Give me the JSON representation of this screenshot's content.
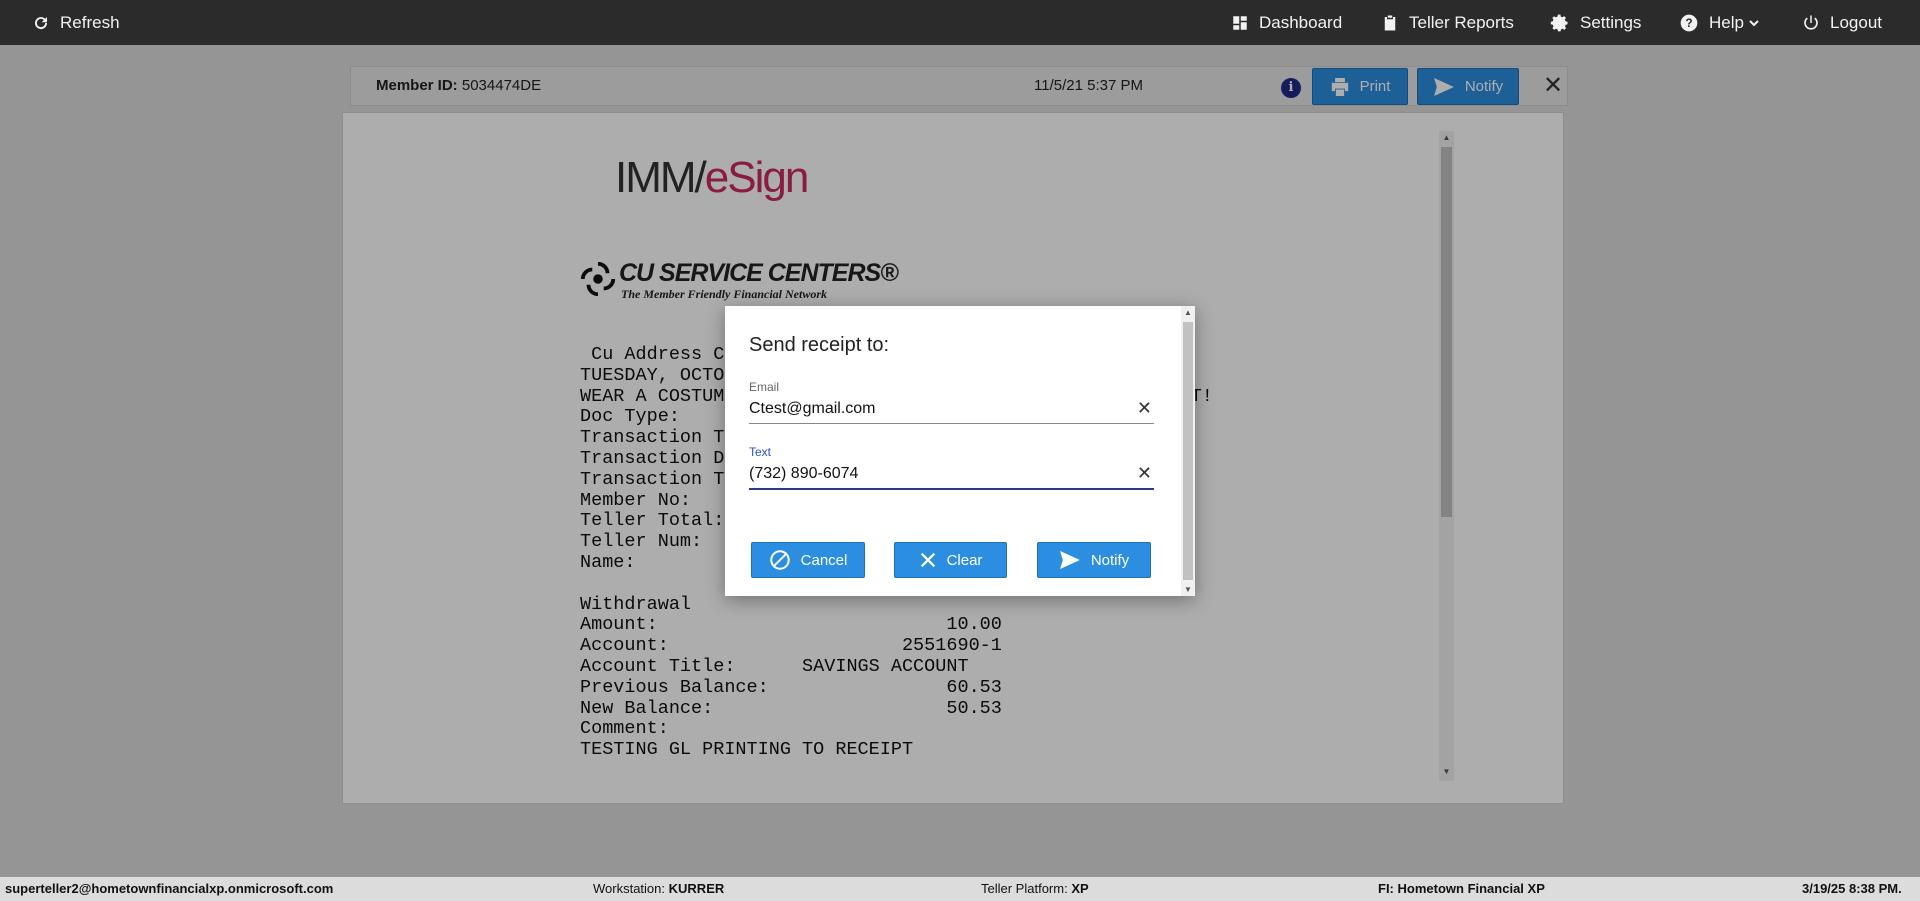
{
  "topbar": {
    "refresh": "Refresh",
    "dashboard": "Dashboard",
    "teller_reports": "Teller Reports",
    "settings": "Settings",
    "help": "Help",
    "logout": "Logout"
  },
  "receipt_header": {
    "member_label": "Member ID:",
    "member_id": "5034474DE",
    "datetime": "11/5/21 5:37 PM",
    "info": "i",
    "print_label": "Print",
    "notify_label": "Notify",
    "close": "✕"
  },
  "receipt": {
    "logo_part1": "IMM/",
    "logo_part2": "eSign",
    "cusc_name": "CU SERVICE CENTERS®",
    "cusc_tagline": "The Member Friendly Financial Network",
    "body": " Cu Address C\nTUESDAY, OCTO\nWEAR A COSTUM                                         AT!\nDoc Type:\nTransaction T\nTransaction D\nTransaction T\nMember No:\nTeller Total:\nTeller Num:\nName:\n\nWithdrawal\nAmount:                          10.00\nAccount:                     2551690-1\nAccount Title:      SAVINGS ACCOUNT\nPrevious Balance:                60.53\nNew Balance:                     50.53\nComment:\nTESTING GL PRINTING TO RECEIPT"
  },
  "modal": {
    "title": "Send receipt to:",
    "email_label": "Email",
    "email_value": "Ctest@gmail.com",
    "text_label": "Text",
    "text_value": "(732) 890-6074",
    "clear_glyph": "✕",
    "cancel": "Cancel",
    "clear": "Clear",
    "notify": "Notify"
  },
  "statusbar": {
    "user": "superteller2@hometownfinancialxp.onmicrosoft.com",
    "workstation_label": "Workstation:",
    "workstation": "KURRER",
    "platform_label": "Teller Platform:",
    "platform": "XP",
    "fi_label": "FI:",
    "fi": "Hometown Financial XP",
    "datetime": "3/19/25 8:38 PM."
  },
  "colors": {
    "topbar": "#2b2b2b",
    "accent_blue": "#2c8ee0",
    "active_field": "#2a4fc9",
    "esign_pink": "#c92b5f"
  },
  "icons": [
    "refresh-icon",
    "dashboard-icon",
    "clipboard-icon",
    "gear-icon",
    "help-icon",
    "chevron-down-icon",
    "power-icon",
    "info-icon",
    "printer-icon",
    "send-icon",
    "close-icon",
    "cancel-icon",
    "clear-icon",
    "cusc-logo-icon"
  ]
}
